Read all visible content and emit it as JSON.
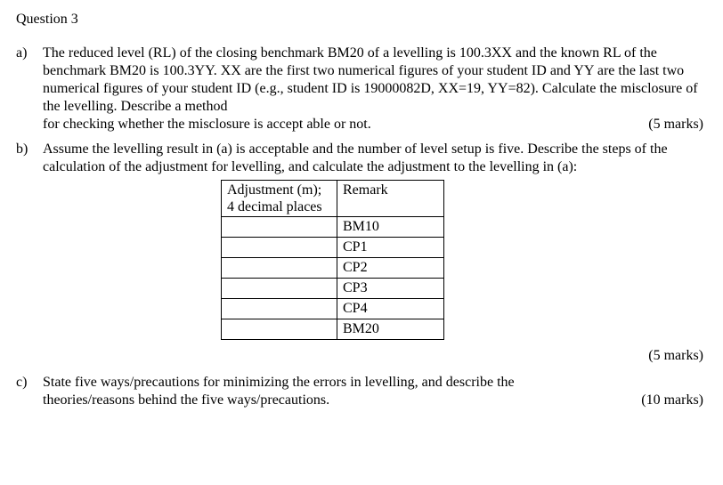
{
  "title": "Question 3",
  "parts": {
    "a": {
      "label": "a)",
      "text_main": "The reduced level (RL) of the closing benchmark BM20 of a levelling is 100.3XX and the known RL of the benchmark BM20 is 100.3YY. XX are the first two numerical figures of your student ID and YY are the last two numerical figures of your student ID (e.g., student ID is 19000082D, XX=19, YY=82). Calculate the misclosure of the levelling. Describe a method",
      "text_last": "for checking whether the misclosure is accept able or not.",
      "marks": "(5 marks)"
    },
    "b": {
      "label": "b)",
      "text": "Assume the levelling result in (a) is acceptable and the number of level setup is five. Describe the steps of the calculation of the adjustment for levelling, and calculate the adjustment to the levelling in (a):",
      "marks": "(5 marks)",
      "table": {
        "header_adj_l1": "Adjustment (m);",
        "header_adj_l2": "4 decimal places",
        "header_remark": "Remark",
        "rows": [
          {
            "adj": "",
            "remark": "BM10"
          },
          {
            "adj": "",
            "remark": "CP1"
          },
          {
            "adj": "",
            "remark": "CP2"
          },
          {
            "adj": "",
            "remark": "CP3"
          },
          {
            "adj": "",
            "remark": "CP4"
          },
          {
            "adj": "",
            "remark": "BM20"
          }
        ]
      }
    },
    "c": {
      "label": "c)",
      "text_main": "State five ways/precautions for minimizing the errors in levelling, and describe the",
      "text_last": "theories/reasons behind the five ways/precautions.",
      "marks": "(10 marks)"
    }
  }
}
